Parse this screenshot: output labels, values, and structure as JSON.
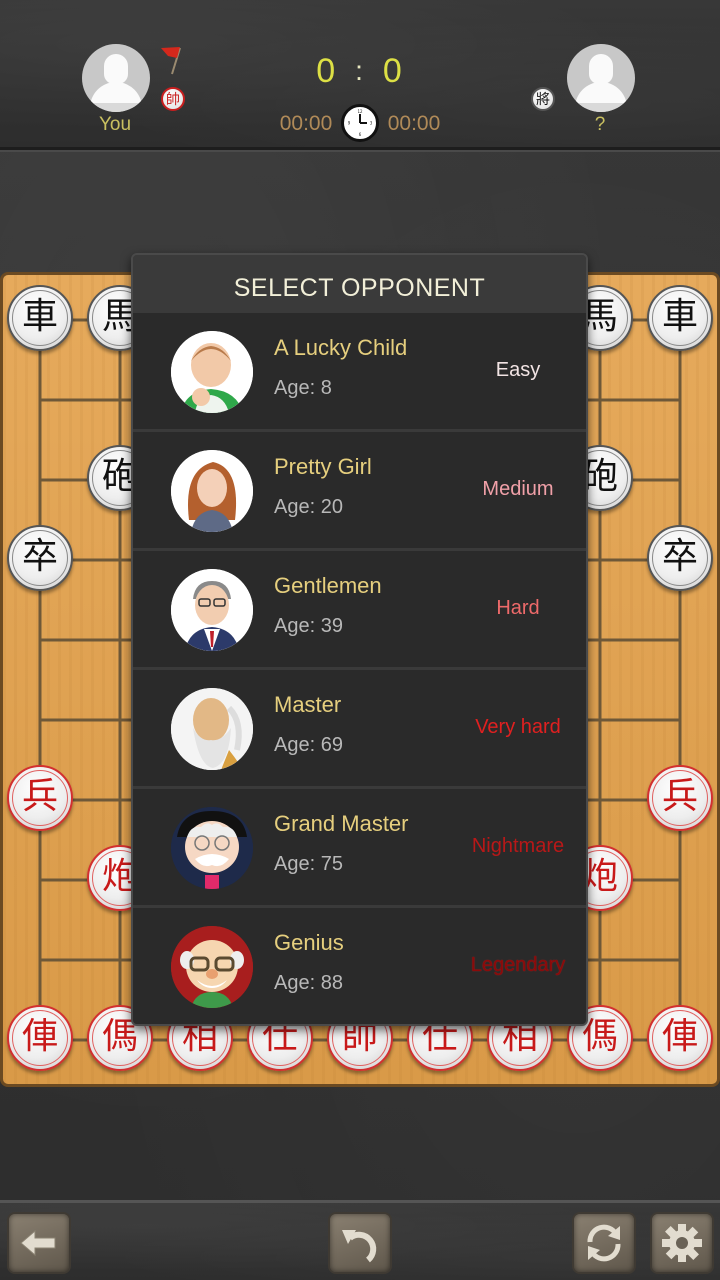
{
  "header": {
    "player": {
      "name": "You",
      "piece": "帥",
      "flag_icon": "red-flag-icon"
    },
    "opponent": {
      "name": "?",
      "piece": "將"
    },
    "score": {
      "player": "0",
      "separator": ":",
      "opponent": "0"
    },
    "timers": {
      "player": "00:00",
      "opponent": "00:00",
      "icon": "clock-icon"
    }
  },
  "board": {
    "black_pieces": [
      {
        "char": "車",
        "pos": "top-left-corner"
      },
      {
        "char": "馬",
        "pos": "top-left"
      },
      {
        "char": "馬",
        "pos": "top-right"
      },
      {
        "char": "車",
        "pos": "top-right-corner"
      },
      {
        "char": "砲",
        "pos": "left-cannon"
      },
      {
        "char": "砲",
        "pos": "right-cannon"
      },
      {
        "char": "卒",
        "pos": "left-soldier"
      },
      {
        "char": "卒",
        "pos": "right-soldier"
      }
    ],
    "red_pieces": [
      {
        "char": "兵",
        "pos": "left-soldier"
      },
      {
        "char": "兵",
        "pos": "right-soldier"
      },
      {
        "char": "炮",
        "pos": "left-cannon"
      },
      {
        "char": "炮",
        "pos": "right-cannon"
      },
      {
        "char": "俥"
      },
      {
        "char": "傌"
      },
      {
        "char": "相"
      },
      {
        "char": "仕"
      },
      {
        "char": "帥"
      },
      {
        "char": "仕"
      },
      {
        "char": "相"
      },
      {
        "char": "傌"
      },
      {
        "char": "俥"
      }
    ]
  },
  "modal": {
    "title": "SELECT OPPONENT",
    "opponents": [
      {
        "name": "A Lucky Child",
        "age": "Age: 8",
        "level": "Easy",
        "level_color": "#f2e4e4"
      },
      {
        "name": "Pretty Girl",
        "age": "Age: 20",
        "level": "Medium",
        "level_color": "#f0a0a8"
      },
      {
        "name": "Gentlemen",
        "age": "Age: 39",
        "level": "Hard",
        "level_color": "#ee6a6a"
      },
      {
        "name": "Master",
        "age": "Age: 69",
        "level": "Very hard",
        "level_color": "#e02020"
      },
      {
        "name": "Grand Master",
        "age": "Age: 75",
        "level": "Nightmare",
        "level_color": "#b81818"
      },
      {
        "name": "Genius",
        "age": "Age: 88",
        "level": "Legendary",
        "level_color": "#8a0a0a"
      }
    ]
  },
  "toolbar": {
    "back": "back-arrow-icon",
    "undo": "undo-icon",
    "restart": "refresh-icon",
    "settings": "gear-icon"
  }
}
